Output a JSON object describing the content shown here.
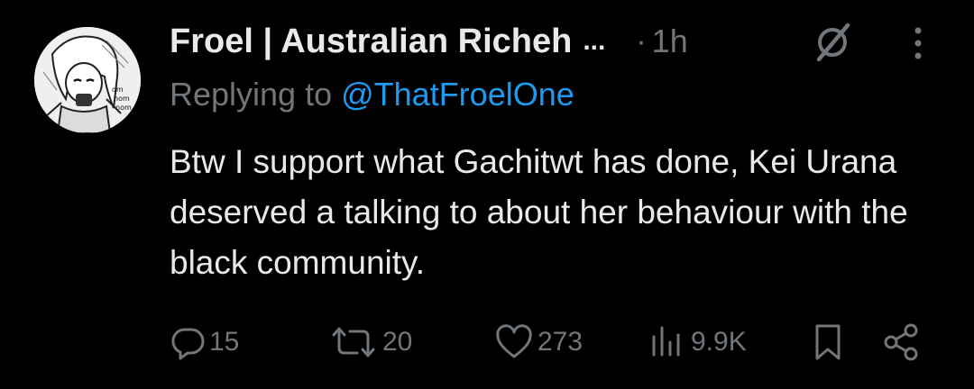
{
  "tweet": {
    "author": {
      "display_name": "Froel | Australian Richeh",
      "truncation": "...",
      "avatar_text": [
        "om",
        "nom",
        "nom"
      ]
    },
    "separator": "·",
    "time": "1h",
    "reply": {
      "prefix": "Replying to ",
      "handle": "@ThatFroelOne"
    },
    "text": "Btw I support what Gachitwt has done, Kei Urana deserved a talking to about her behaviour with the black community."
  },
  "actions": {
    "replies": "15",
    "reposts": "20",
    "likes": "273",
    "views": "9.9K"
  },
  "colors": {
    "background": "#000000",
    "text_primary": "#e7e9ea",
    "text_secondary": "#71767b",
    "accent": "#1d9bf0"
  },
  "icons": [
    "grok-icon",
    "more-icon",
    "reply-icon",
    "repost-icon",
    "like-icon",
    "views-icon",
    "bookmark-icon",
    "share-icon"
  ]
}
